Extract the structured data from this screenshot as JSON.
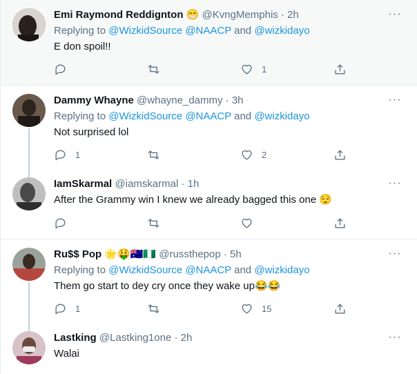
{
  "tweets": [
    {
      "name": "Emi Raymond Reddignton",
      "emoji": "😁",
      "handle": "@KvngMemphis",
      "time": "· 2h",
      "replying_prefix": "Replying to",
      "mentions": [
        "@WizkidSource",
        "@NAACP",
        "@wizkidayo"
      ],
      "and": "and",
      "text": "E don spoil!!",
      "reply_count": "",
      "retweet_count": "",
      "like_count": "1"
    },
    {
      "name": "Dammy Whayne",
      "handle": "@whayne_dammy",
      "time": "· 3h",
      "replying_prefix": "Replying to",
      "mentions": [
        "@WizkidSource",
        "@NAACP",
        "@wizkidayo"
      ],
      "and": "and",
      "text": "Not surprised lol",
      "reply_count": "1",
      "retweet_count": "",
      "like_count": "2"
    },
    {
      "name": "IamSkarmal",
      "handle": "@iamskarmal",
      "time": "· 1h",
      "text": "After the Grammy win I knew we already bagged this one",
      "emoji": "😌",
      "reply_count": "",
      "retweet_count": "",
      "like_count": ""
    },
    {
      "name": "Ru$$ Pop",
      "name_emojis": "🌟🤑🇦🇺🇳🇬",
      "handle": "@russthepop",
      "time": "· 5h",
      "replying_prefix": "Replying to",
      "mentions": [
        "@WizkidSource",
        "@NAACP",
        "@wizkidayo"
      ],
      "and": "and",
      "text": "Them go start to dey cry once they wake up",
      "emoji": "😂😂",
      "reply_count": "1",
      "retweet_count": "",
      "like_count": "15"
    },
    {
      "name": "Lastking",
      "handle": "@Lastking1one",
      "time": "· 2h",
      "text": "Walai"
    }
  ],
  "more_label": "···",
  "icons": {
    "reply": "reply-icon",
    "retweet": "retweet-icon",
    "like": "heart-icon",
    "share": "share-icon",
    "more": "more-icon"
  }
}
